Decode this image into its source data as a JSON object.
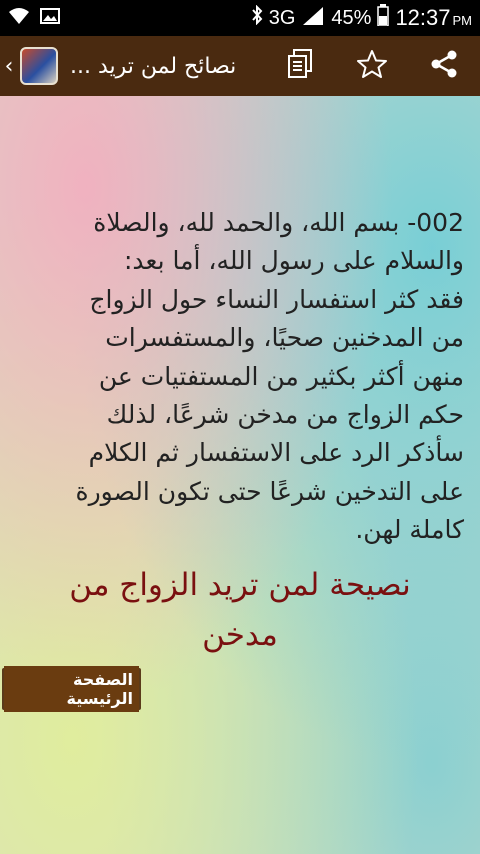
{
  "status_bar": {
    "network": "3G",
    "battery": "45%",
    "time": "12:37",
    "ampm": "PM",
    "icons": [
      "wifi-icon",
      "image-icon",
      "bluetooth-icon",
      "signal-icon",
      "battery-icon"
    ]
  },
  "action_bar": {
    "title": "نصائح لمن تريد ...",
    "icons": [
      "chevron-left-icon",
      "app-icon",
      "copy-icon",
      "star-icon",
      "share-icon"
    ]
  },
  "content": {
    "body_lines": [
      "002- بسم الله، والحمد لله، والصلاة",
      "والسلام على رسول الله، أما بعد:",
      "فقد كثر استفسار النساء حول الزواج",
      "من المدخنين صحيًا، والمستفسرات",
      "منهن أكثر بكثير من المستفتيات عن",
      "حكم الزواج من مدخن شرعًا، لذلك",
      "سأذكر الرد على الاستفسار ثم الكلام",
      "على التدخين شرعًا حتى تكون الصورة",
      "كاملة لهن."
    ],
    "heading_lines": [
      "نصيحة لمن تريد الزواج من",
      "مدخن"
    ],
    "home_button_label": "الصفحة الرئيسية"
  },
  "colors": {
    "action_bar_bg": "#4a2a10",
    "heading_color": "#7a1010",
    "button_label_bg": "#6a3c10"
  }
}
